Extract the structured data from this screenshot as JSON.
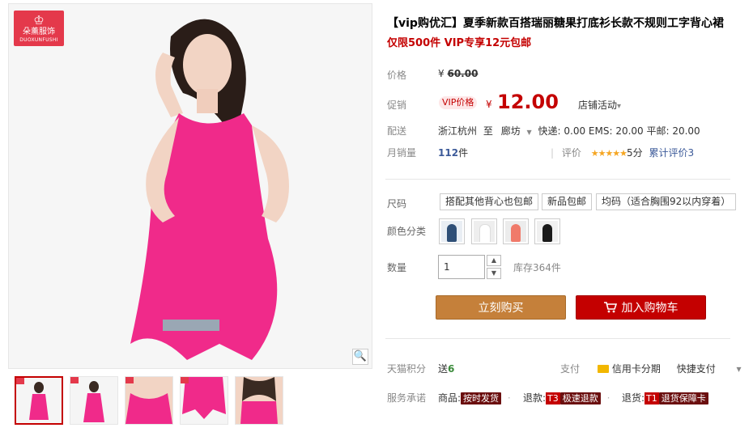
{
  "logo": {
    "glyph": "♔",
    "cn": "朵薰服饰",
    "en": "DUOXUNFUSHI"
  },
  "product": {
    "title": "【vip购优汇】夏季新款百搭瑞丽糖果打底衫长款不规则工字背心裙",
    "subtitle": "仅限500件 VIP专享12元包邮"
  },
  "price": {
    "label": "价格",
    "currency": "¥",
    "original": "60.00"
  },
  "promo": {
    "label": "促销",
    "vip_badge": "VIP价格",
    "currency": "¥",
    "price": "12.00",
    "store_activity": "店铺活动",
    "chevron": "▾"
  },
  "delivery": {
    "label": "配送",
    "from": "浙江杭州",
    "to_word": "至",
    "to": "廊坊",
    "caret": "▼",
    "fees": "快递: 0.00 EMS: 20.00 平邮: 20.00"
  },
  "sales": {
    "label": "月销量",
    "count": "112",
    "unit": "件",
    "rating_label": "评价",
    "stars": "★★★★★",
    "score": "5分",
    "reviews": "累计评价3"
  },
  "size": {
    "label": "尺码",
    "options": [
      "搭配其他背心也包邮",
      "新品包邮",
      "均码（适合胸围92以内穿着）"
    ]
  },
  "color": {
    "label": "颜色分类",
    "options": [
      {
        "name": "navy",
        "color": "#2f4f77"
      },
      {
        "name": "white",
        "color": "#ffffff"
      },
      {
        "name": "coral",
        "color": "#f07a6a"
      },
      {
        "name": "black",
        "color": "#1a1a1a"
      }
    ]
  },
  "quantity": {
    "label": "数量",
    "value": "1",
    "up": "▲",
    "down": "▼",
    "stock": "库存364件"
  },
  "actions": {
    "buy_now": "立刻购买",
    "add_to_cart": "加入购物车"
  },
  "points": {
    "label": "天猫积分",
    "send": "送",
    "amount": "6",
    "pay_label": "支付",
    "credit": "信用卡分期",
    "quick_pay": "快捷支付",
    "more": "▾"
  },
  "service": {
    "label": "服务承诺",
    "goods_label": "商品:",
    "goods_tag": "按时发货",
    "refund_label": "退款:",
    "refund_code": "T3",
    "refund_tag": "极速退款",
    "return_label": "退货:",
    "return_code": "T1",
    "return_tag": "退货保障卡"
  },
  "zoom_icon": "🔍",
  "colors": {
    "accent": "#c40000",
    "buy_button": "#c5803a",
    "link": "#3c5a99",
    "star": "#f5a623"
  }
}
